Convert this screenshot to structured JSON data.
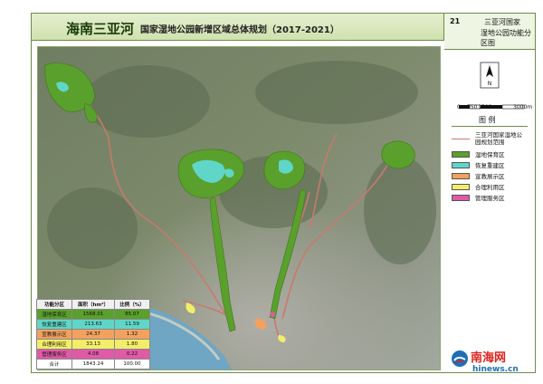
{
  "header": {
    "title": "海南三亚河",
    "subtitle": "国家湿地公园新增区域总体规划（2017-2021）",
    "map_number": "21",
    "map_name_line1": "三亚河国家",
    "map_name_line2": "湿地公园功能分区图"
  },
  "scale": {
    "labels": [
      "0",
      "750",
      "1500",
      "3000m"
    ]
  },
  "legend": {
    "title": "图 例",
    "items": [
      {
        "label": "三亚河国家湿地公园规划范围",
        "kind": "boundary",
        "color": "#c9796e"
      },
      {
        "label": "湿地保育区",
        "kind": "fill",
        "color": "#5aa02c"
      },
      {
        "label": "恢复重建区",
        "kind": "fill",
        "color": "#5fd6c8"
      },
      {
        "label": "宣教展示区",
        "kind": "fill",
        "color": "#f2a15f"
      },
      {
        "label": "合理利用区",
        "kind": "fill",
        "color": "#f2ee6a"
      },
      {
        "label": "管理服务区",
        "kind": "fill",
        "color": "#e05aa8"
      }
    ]
  },
  "table": {
    "headers": [
      "功能分区",
      "面积（hm²）",
      "比例（%）"
    ],
    "rows": [
      {
        "name": "湿地保育区",
        "area": "1568.01",
        "ratio": "85.07",
        "color": "#5aa02c"
      },
      {
        "name": "恢复重建区",
        "area": "213.63",
        "ratio": "11.59",
        "color": "#5fd6c8"
      },
      {
        "name": "宣教展示区",
        "area": "24.37",
        "ratio": "1.32",
        "color": "#f2a15f"
      },
      {
        "name": "合理利用区",
        "area": "33.13",
        "ratio": "1.80",
        "color": "#f2ee6a"
      },
      {
        "name": "管理服务区",
        "area": "4.08",
        "ratio": "0.22",
        "color": "#e05aa8"
      }
    ],
    "total": {
      "name": "合计",
      "area": "1843.24",
      "ratio": "100.00"
    }
  },
  "logo": {
    "text": "南海网",
    "url": "hinews.cn"
  }
}
